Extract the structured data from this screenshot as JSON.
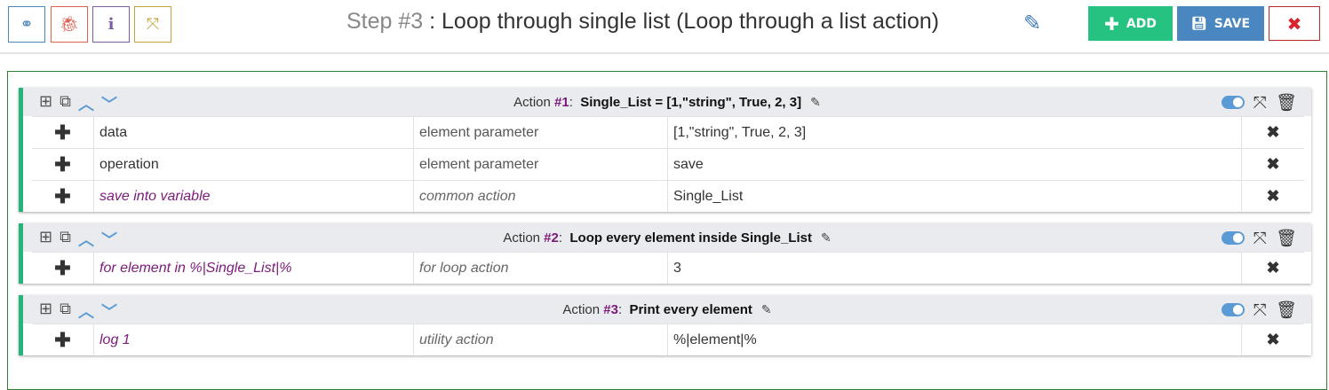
{
  "toolbar": {
    "buttons": [
      {
        "icon": "toggle-icon",
        "color": "#4f86b8"
      },
      {
        "icon": "bug-icon",
        "color": "#e0604f"
      },
      {
        "icon": "info-icon",
        "color": "#7a5fa0"
      },
      {
        "icon": "expand-icon",
        "color": "#c9a23a"
      }
    ]
  },
  "header": {
    "step_label": "Step #3",
    "title": " : Loop through single list (Loop through a list action)",
    "add_label": "ADD",
    "save_label": "SAVE",
    "add_color": "#26c281",
    "save_color": "#4a86c0",
    "close_color": "#d9232d"
  },
  "actions": [
    {
      "prefix": "Action ",
      "num": "#1",
      "sep": ":  ",
      "name": "Single_List = [1,\"string\", True, 2, 3]",
      "rows": [
        {
          "name": "data",
          "type": "element parameter",
          "value": "[1,\"string\", True, 2, 3]",
          "italic": false
        },
        {
          "name": "operation",
          "type": "element parameter",
          "value": "save",
          "italic": false
        },
        {
          "name": "save into variable",
          "type": "common action",
          "value": "Single_List",
          "italic": true
        }
      ]
    },
    {
      "prefix": "Action ",
      "num": "#2",
      "sep": ":  ",
      "name": "Loop every element inside Single_List",
      "rows": [
        {
          "name": "for element in %|Single_List|%",
          "type": "for loop action",
          "value": "3",
          "italic": true
        }
      ]
    },
    {
      "prefix": "Action ",
      "num": "#3",
      "sep": ":  ",
      "name": "Print every element",
      "rows": [
        {
          "name": "log 1",
          "type": "utility action",
          "value": "%|element|%",
          "italic": true
        }
      ]
    }
  ]
}
